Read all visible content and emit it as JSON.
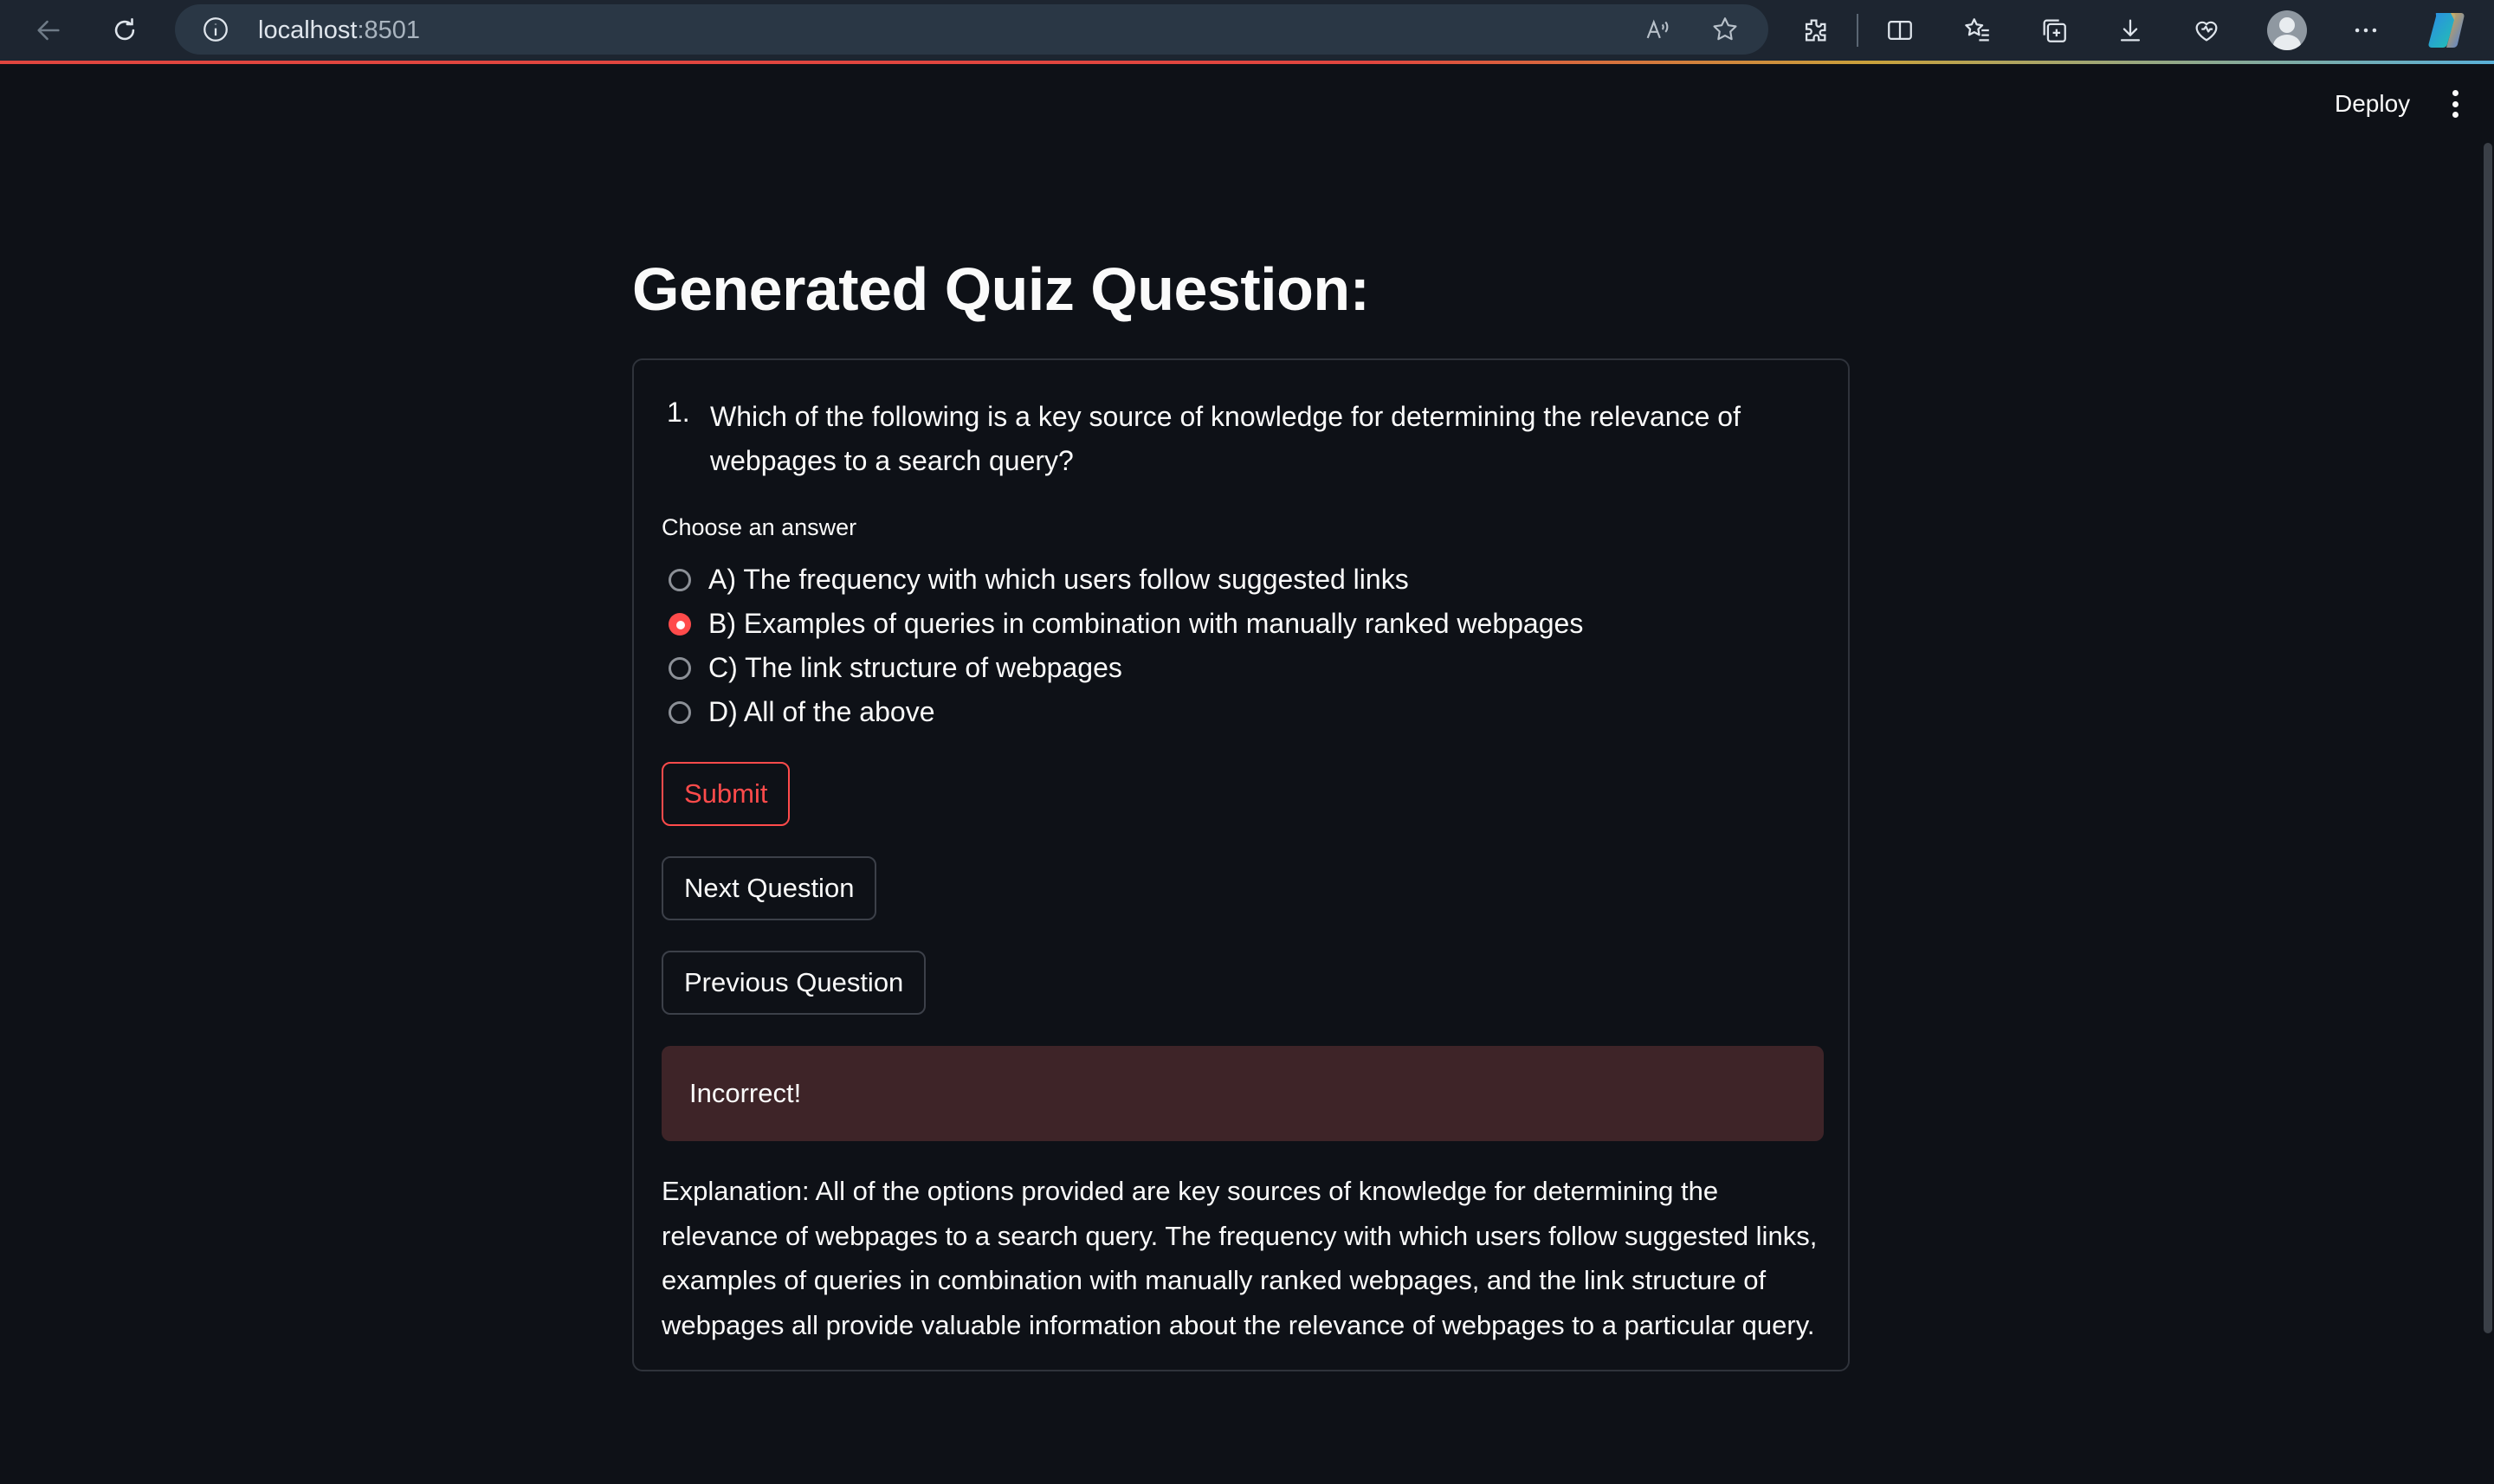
{
  "browser": {
    "url_host": "localhost",
    "url_port": ":8501",
    "icons": [
      "back-arrow-icon",
      "refresh-icon",
      "site-info-icon",
      "read-aloud-icon",
      "favorite-star-icon",
      "extensions-icon",
      "split-screen-icon",
      "favorites-icon",
      "collections-icon",
      "downloads-icon",
      "browser-essentials-icon",
      "profile-avatar-icon",
      "more-menu-icon",
      "copilot-icon"
    ]
  },
  "toolbar": {
    "deploy_label": "Deploy"
  },
  "page": {
    "title": "Generated Quiz Question:"
  },
  "quiz": {
    "question_number": "1.",
    "question_text": "Which of the following is a key source of knowledge for determining the relevance of webpages to a search query?",
    "choose_label": "Choose an answer",
    "options": [
      {
        "label": "A) The frequency with which users follow suggested links",
        "selected": false
      },
      {
        "label": "B) Examples of queries in combination with manually ranked webpages",
        "selected": true
      },
      {
        "label": "C) The link structure of webpages",
        "selected": false
      },
      {
        "label": "D) All of the above",
        "selected": false
      }
    ],
    "submit_label": "Submit",
    "next_label": "Next Question",
    "previous_label": "Previous Question",
    "result_text": "Incorrect!",
    "explanation": "Explanation: All of the options provided are key sources of knowledge for determining the relevance of webpages to a search query. The frequency with which users follow suggested links, examples of queries in combination with manually ranked webpages, and the link structure of webpages all provide valuable information about the relevance of webpages to a particular query."
  },
  "colors": {
    "background": "#0e1117",
    "accent": "#ff4b4b",
    "error_bg": "#3e2428",
    "border": "#2f333b"
  }
}
